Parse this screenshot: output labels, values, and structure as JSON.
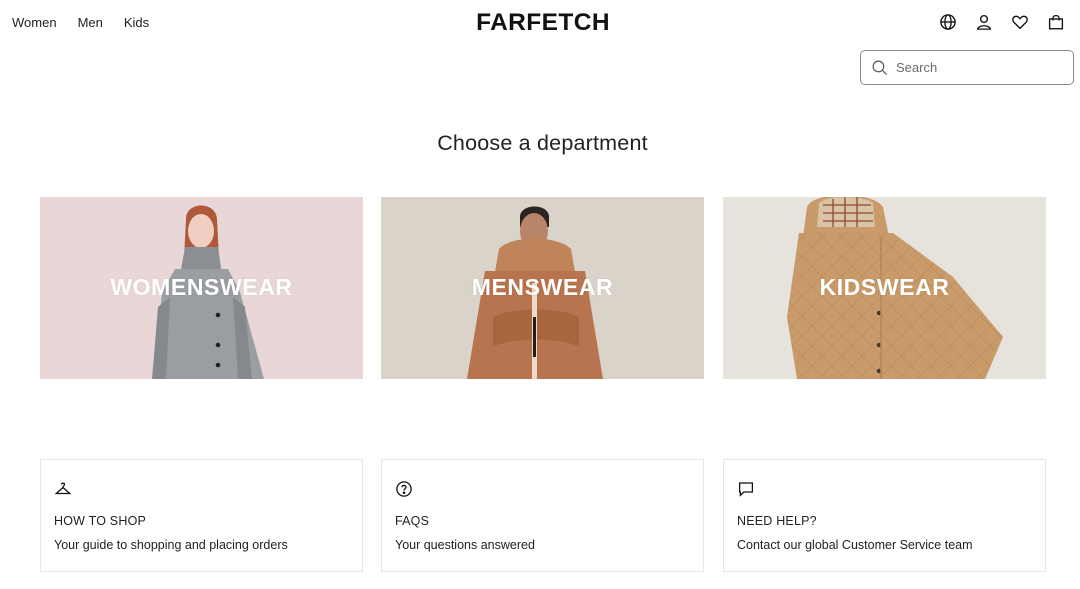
{
  "header": {
    "nav": [
      {
        "label": "Women"
      },
      {
        "label": "Men"
      },
      {
        "label": "Kids"
      }
    ],
    "logo": "FARFETCH",
    "icons": [
      "globe-icon",
      "account-icon",
      "wishlist-heart-icon",
      "shopping-bag-icon"
    ]
  },
  "search": {
    "placeholder": "Search",
    "value": ""
  },
  "main": {
    "title": "Choose a department",
    "departments": [
      {
        "label": "WOMENSWEAR",
        "background": "#ecdcdb"
      },
      {
        "label": "MENSWEAR",
        "background": "#d9d3ca"
      },
      {
        "label": "KIDSWEAR",
        "background": "#e6e2dc"
      }
    ]
  },
  "help": [
    {
      "icon": "hanger-icon",
      "title": "HOW TO SHOP",
      "description": "Your guide to shopping and placing orders"
    },
    {
      "icon": "question-circle-icon",
      "title": "FAQS",
      "description": "Your questions answered"
    },
    {
      "icon": "chat-bubble-icon",
      "title": "NEED HELP?",
      "description": "Contact our global Customer Service team"
    }
  ],
  "colors": {
    "text": "#222222",
    "border": "#e6e6e6",
    "search_border": "#8a8a8a",
    "background": "#ffffff"
  }
}
